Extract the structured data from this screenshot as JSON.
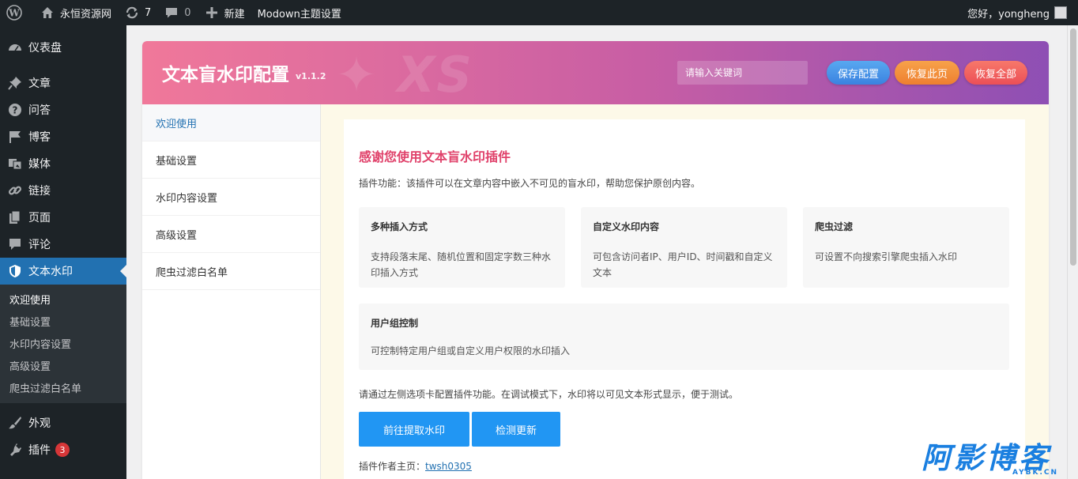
{
  "admin_bar": {
    "site_name": "永恒资源网",
    "updates_count": "7",
    "comments_count": "0",
    "new_label": "新建",
    "theme_settings_label": "Modown主题设置",
    "greeting": "您好，yongheng"
  },
  "sidebar": {
    "items": [
      {
        "label": "仪表盘",
        "icon": "dashboard-icon"
      },
      {
        "label": "文章",
        "icon": "pin-icon"
      },
      {
        "label": "问答",
        "icon": "question-icon"
      },
      {
        "label": "博客",
        "icon": "flag-icon"
      },
      {
        "label": "媒体",
        "icon": "media-icon"
      },
      {
        "label": "链接",
        "icon": "link-icon"
      },
      {
        "label": "页面",
        "icon": "page-icon"
      },
      {
        "label": "评论",
        "icon": "comment-icon"
      },
      {
        "label": "文本水印",
        "icon": "shield-icon"
      }
    ],
    "submenu": [
      "欢迎使用",
      "基础设置",
      "水印内容设置",
      "高级设置",
      "爬虫过滤白名单"
    ],
    "after": [
      {
        "label": "外观",
        "icon": "brush-icon"
      },
      {
        "label": "插件",
        "icon": "plugin-icon",
        "badge": "3"
      }
    ]
  },
  "panel": {
    "title": "文本盲水印配置",
    "version": "v1.1.2",
    "search_placeholder": "请输入关键词",
    "buttons": {
      "save": "保存配置",
      "reset_page": "恢复此页",
      "reset_all": "恢复全部"
    },
    "tabs": [
      "欢迎使用",
      "基础设置",
      "水印内容设置",
      "高级设置",
      "爬虫过滤白名单"
    ]
  },
  "welcome": {
    "title": "感谢您使用文本盲水印插件",
    "description": "插件功能：该插件可以在文章内容中嵌入不可见的盲水印，帮助您保护原创内容。",
    "features": [
      {
        "title": "多种插入方式",
        "desc": "支持段落末尾、随机位置和固定字数三种水印插入方式"
      },
      {
        "title": "自定义水印内容",
        "desc": "可包含访问者IP、用户ID、时间戳和自定义文本"
      },
      {
        "title": "爬虫过滤",
        "desc": "可设置不向搜索引擎爬虫插入水印"
      },
      {
        "title": "用户组控制",
        "desc": "可控制特定用户组或自定义用户权限的水印插入"
      }
    ],
    "note": "请通过左侧选项卡配置插件功能。在调试模式下，水印将以可见文本形式显示，便于测试。",
    "buttons": {
      "extract": "前往提取水印",
      "check": "检测更新"
    },
    "author_label": "插件作者主页：",
    "author_link": "twsh0305"
  },
  "corner_logo": {
    "main": "阿影博客",
    "sub": "AYBK.CN"
  },
  "colors": {
    "wp_blue": "#2271b1",
    "admin_dark": "#1d2327",
    "title_pink": "#e0426b",
    "button_blue": "#2196f3"
  }
}
